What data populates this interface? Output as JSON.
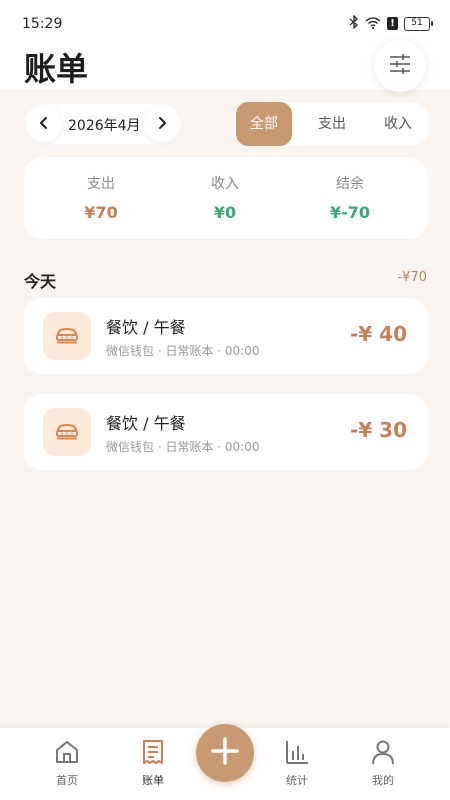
{
  "status_bar": {
    "time": "15:29",
    "battery": "51",
    "alert": "!"
  },
  "header": {
    "title": "账单"
  },
  "month_picker": {
    "label": "2026年4月"
  },
  "segments": [
    {
      "label": "全部",
      "active": true
    },
    {
      "label": "支出",
      "active": false
    },
    {
      "label": "收入",
      "active": false
    }
  ],
  "summary": {
    "expense_label": "支出",
    "expense_value": "¥70",
    "income_label": "收入",
    "income_value": "¥0",
    "balance_label": "结余",
    "balance_value": "¥-70",
    "colors": {
      "expense": "#c58058",
      "income": "#3aa77a",
      "balance": "#3aa77a"
    }
  },
  "day_group": {
    "label": "今天",
    "total": "-¥70"
  },
  "transactions": [
    {
      "title": "餐饮 / 午餐",
      "subtitle": "微信钱包 · 日常账本 · 00:00",
      "amount": "-¥ 40",
      "icon": "food-icon"
    },
    {
      "title": "餐饮 / 午餐",
      "subtitle": "微信钱包 · 日常账本 · 00:00",
      "amount": "-¥ 30",
      "icon": "food-icon"
    }
  ],
  "tabbar": {
    "items": [
      {
        "label": "首页",
        "icon": "home-icon"
      },
      {
        "label": "账单",
        "icon": "bill-icon",
        "active": true
      },
      {
        "label": "统计",
        "icon": "chart-icon"
      },
      {
        "label": "我的",
        "icon": "user-icon"
      }
    ],
    "fab_icon": "plus-icon"
  },
  "colors": {
    "accent": "#c99a72",
    "background": "#f9f4ef"
  }
}
